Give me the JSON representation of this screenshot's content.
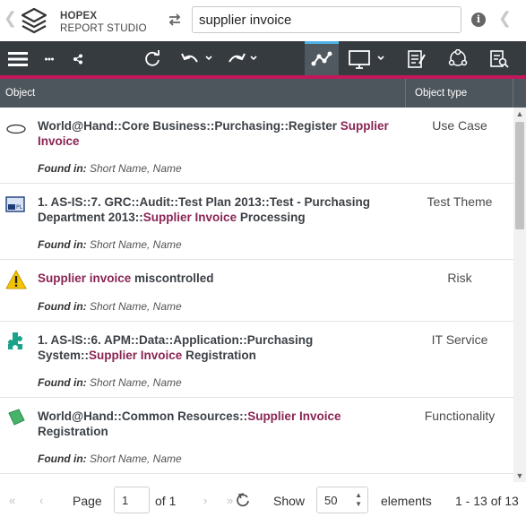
{
  "header": {
    "brand_line1": "HOPEX",
    "brand_line2": "REPORT STUDIO",
    "search_value": "supplier invoice",
    "back_arrow": "❮",
    "forward_arrow": "❮"
  },
  "toolbar": {
    "items": [
      "menu-icon",
      "more-icon",
      "share-icon",
      "refresh-icon",
      "undo-icon",
      "redo-icon",
      "graph-icon",
      "display-icon",
      "report-icon",
      "network-icon",
      "document-search-icon"
    ],
    "active": "graph-icon",
    "accent_color": "#c2185b"
  },
  "columns": {
    "object": "Object",
    "object_type": "Object type"
  },
  "rows": [
    {
      "icon": "use-case-icon",
      "title_parts": [
        {
          "text": "World@Hand::Core Business::Purchasing::Register ",
          "hl": false
        },
        {
          "text": "Supplier Invoice",
          "hl": true
        }
      ],
      "type": "Use Case",
      "found_label": "Found in:",
      "found_value": " Short Name, Name"
    },
    {
      "icon": "test-theme-icon",
      "title_parts": [
        {
          "text": "1. AS-IS::7. GRC::Audit::Test Plan 2013::Test - Purchasing Department 2013::",
          "hl": false
        },
        {
          "text": "Supplier Invoice",
          "hl": true
        },
        {
          "text": " Processing",
          "hl": false
        }
      ],
      "type": "Test Theme",
      "found_label": "Found in:",
      "found_value": " Short Name, Name"
    },
    {
      "icon": "risk-icon",
      "title_parts": [
        {
          "text": "Supplier invoice",
          "hl": true
        },
        {
          "text": " miscontrolled",
          "hl": false
        }
      ],
      "type": "Risk",
      "found_label": "Found in:",
      "found_value": " Short Name, Name"
    },
    {
      "icon": "it-service-icon",
      "title_parts": [
        {
          "text": "1. AS-IS::6. APM::Data::Application::Purchasing System::",
          "hl": false
        },
        {
          "text": "Supplier Invoice",
          "hl": true
        },
        {
          "text": " Registration",
          "hl": false
        }
      ],
      "type": "IT Service",
      "found_label": "Found in:",
      "found_value": " Short Name, Name"
    },
    {
      "icon": "functionality-icon",
      "title_parts": [
        {
          "text": "World@Hand::Common Resources::",
          "hl": false
        },
        {
          "text": "Supplier Invoice",
          "hl": true
        },
        {
          "text": " Registration",
          "hl": false
        }
      ],
      "type": "Functionality",
      "found_label": "Found in:",
      "found_value": " Short Name, Name"
    }
  ],
  "pager": {
    "page_label": "Page",
    "page_value": "1",
    "of_label": "of 1",
    "show_label": "Show",
    "show_value": "50",
    "elements_label": "elements",
    "range_label": "1 - 13 of 13"
  }
}
